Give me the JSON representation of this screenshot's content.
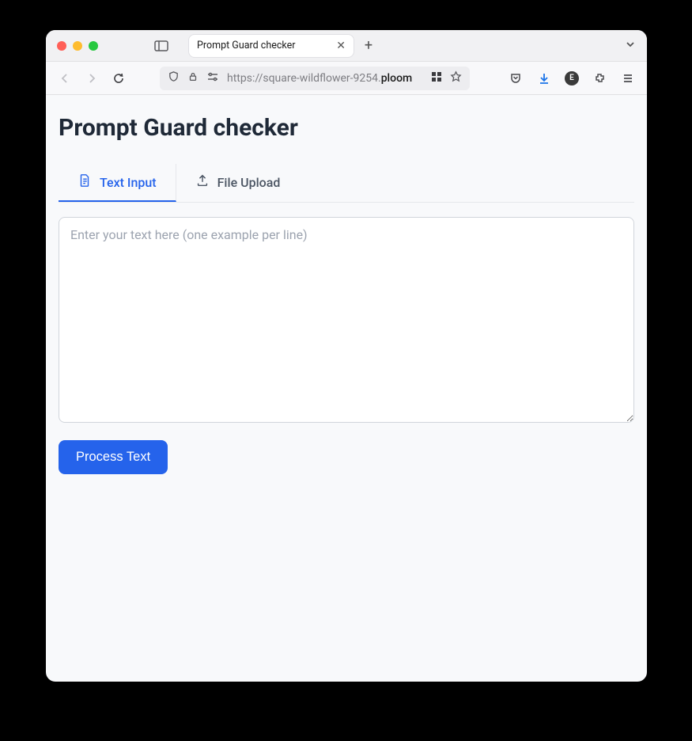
{
  "browser": {
    "tab_title": "Prompt Guard checker",
    "url_prefix": "https://square-wildflower-9254.",
    "url_bold": "ploom",
    "extension_badge": "E"
  },
  "page": {
    "title": "Prompt Guard checker",
    "tabs": [
      {
        "label": "Text Input",
        "active": true
      },
      {
        "label": "File Upload",
        "active": false
      }
    ],
    "textarea": {
      "placeholder": "Enter your text here (one example per line)",
      "value": ""
    },
    "process_button": "Process Text"
  }
}
